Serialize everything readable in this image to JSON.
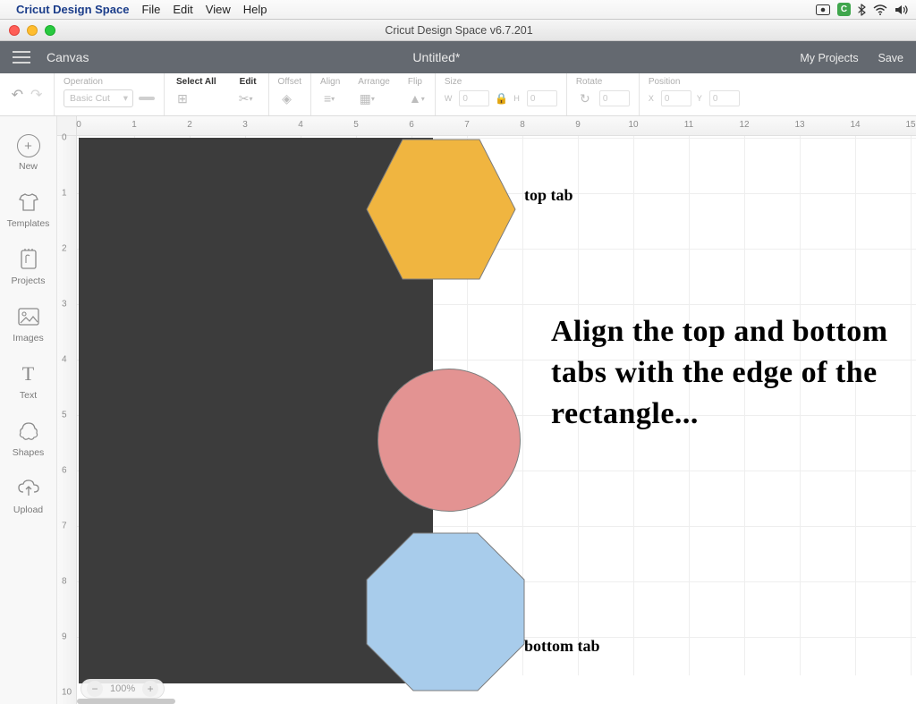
{
  "mac_menu": {
    "app_name": "Cricut Design Space",
    "items": [
      "File",
      "Edit",
      "View",
      "Help"
    ],
    "c_badge": "C"
  },
  "window": {
    "title": "Cricut Design Space  v6.7.201"
  },
  "header": {
    "canvas_label": "Canvas",
    "doc_title": "Untitled*",
    "my_projects": "My Projects",
    "save": "Save"
  },
  "toolbar": {
    "operation_label": "Operation",
    "operation_value": "Basic Cut",
    "select_all": "Select All",
    "edit": "Edit",
    "offset": "Offset",
    "align": "Align",
    "arrange": "Arrange",
    "flip": "Flip",
    "size": "Size",
    "w": "W",
    "w_val": "0",
    "h": "H",
    "h_val": "0",
    "rotate": "Rotate",
    "rot_val": "0",
    "position": "Position",
    "x": "X",
    "x_val": "0",
    "y": "Y",
    "y_val": "0"
  },
  "rail": {
    "new": "New",
    "templates": "Templates",
    "projects": "Projects",
    "images": "Images",
    "text": "Text",
    "shapes": "Shapes",
    "upload": "Upload"
  },
  "rulers": {
    "h": [
      "0",
      "1",
      "2",
      "3",
      "4",
      "5",
      "6",
      "7",
      "8",
      "9",
      "10",
      "11",
      "12",
      "13",
      "14",
      "15"
    ],
    "v": [
      "0",
      "1",
      "2",
      "3",
      "4",
      "5",
      "6",
      "7",
      "8",
      "9",
      "10"
    ]
  },
  "annotations": {
    "top_tab": "top tab",
    "bottom_tab": "bottom tab",
    "instruction": "Align the top and bottom tabs with the edge of the rectangle..."
  },
  "zoom": {
    "pct": "100%"
  },
  "colors": {
    "hex_fill": "#f0b540",
    "circle_fill": "#e39392",
    "oct_fill": "#a8cceb",
    "rect_fill": "#3c3c3c"
  }
}
